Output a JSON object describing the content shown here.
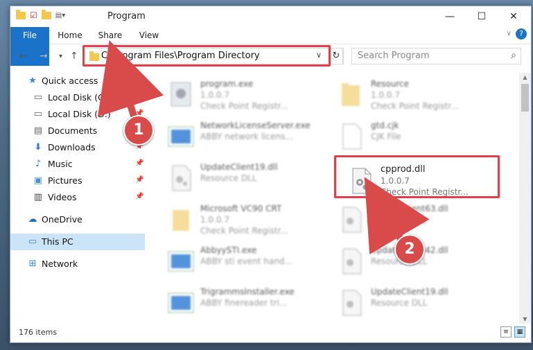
{
  "window": {
    "title": "Program",
    "minimize": "—",
    "maximize": "☐",
    "close": "✕"
  },
  "ribbon": {
    "tabs": [
      "File",
      "Home",
      "Share",
      "View"
    ],
    "help": "?"
  },
  "nav": {
    "back": "←",
    "forward": "→",
    "recent": "▾",
    "up": "↑"
  },
  "address": {
    "path": "C:\\Program Files\\Program Directory",
    "dropdown": "∨",
    "refresh": "↻"
  },
  "search": {
    "placeholder": "Search Program"
  },
  "sidebar": {
    "items": [
      {
        "label": "Quick access",
        "icon": "star-icon"
      },
      {
        "label": "Local Disk (C:)",
        "icon": "drive-icon"
      },
      {
        "label": "Local Disk (D:)",
        "icon": "drive-icon"
      },
      {
        "label": "Documents",
        "icon": "documents-icon"
      },
      {
        "label": "Downloads",
        "icon": "download-icon"
      },
      {
        "label": "Music",
        "icon": "music-icon"
      },
      {
        "label": "Pictures",
        "icon": "pictures-icon"
      },
      {
        "label": "Videos",
        "icon": "videos-icon"
      },
      {
        "label": "OneDrive",
        "icon": "cloud-icon"
      },
      {
        "label": "This PC",
        "icon": "computer-icon"
      },
      {
        "label": "Network",
        "icon": "network-icon"
      }
    ]
  },
  "files": [
    {
      "name": "program.exe",
      "l2": "1.0.0.7",
      "l3": "Check Point Registr..."
    },
    {
      "name": "Resource",
      "l2": "1.0.0.7",
      "l3": "Check Point Registr..."
    },
    {
      "name": "NetworkLicenseServer.exe",
      "l2": "ABBY network licens...",
      "l3": ""
    },
    {
      "name": "gtd.cjk",
      "l2": "CJK File",
      "l3": ""
    },
    {
      "name": "UpdateClient19.dll",
      "l2": "Resource DLL",
      "l3": ""
    },
    {
      "name": "cpprod.dll",
      "l2": "1.0.0.7",
      "l3": "Check Point Registr..."
    },
    {
      "name": "Microsoft VC90 CRT",
      "l2": "1.0.0.7",
      "l3": "Check Point Registr..."
    },
    {
      "name": "UpdateClient63.dll",
      "l2": "Resource DLL",
      "l3": ""
    },
    {
      "name": "AbbyySTI.exe",
      "l2": "ABBY sti event hand...",
      "l3": ""
    },
    {
      "name": "UpdateClient42.dll",
      "l2": "Resource DLL",
      "l3": ""
    },
    {
      "name": "TrigrammsInstaller.exe",
      "l2": "ABBY finereader tri...",
      "l3": ""
    },
    {
      "name": "UpdateClient19.dll",
      "l2": "Resource DLL",
      "l3": ""
    }
  ],
  "status": {
    "count": "176 items"
  },
  "callouts": [
    "1",
    "2"
  ],
  "colors": {
    "accent": "#1a73c8",
    "highlight": "#e0404a",
    "callout": "#d94a4a"
  }
}
